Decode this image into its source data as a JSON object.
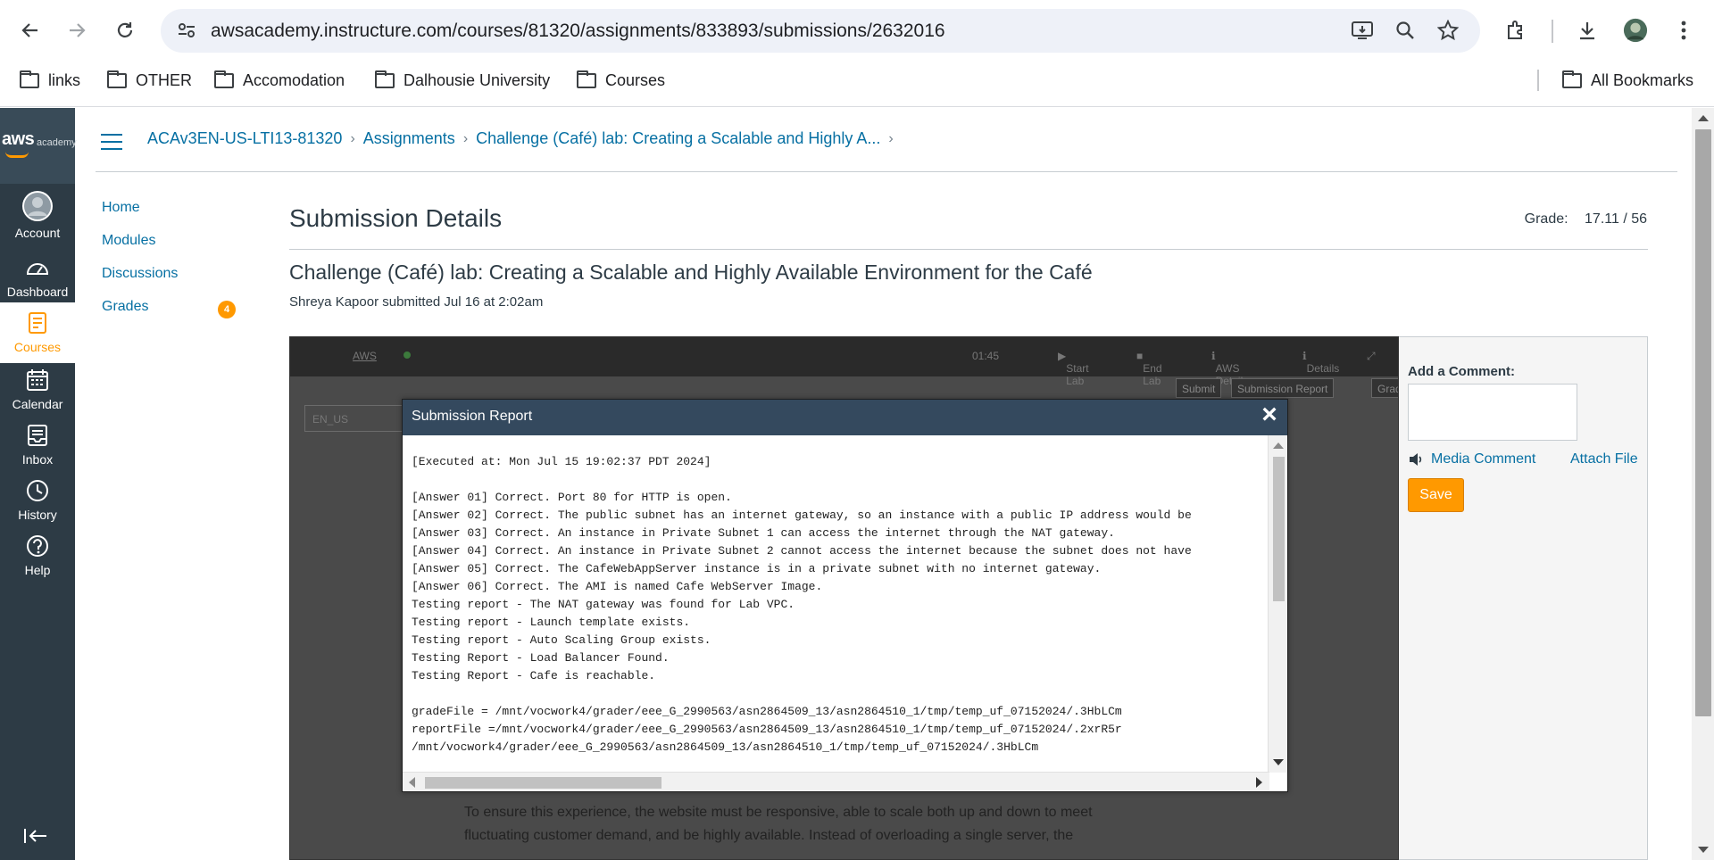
{
  "browser": {
    "url": "awsacademy.instructure.com/courses/81320/assignments/833893/submissions/2632016",
    "bookmarks": [
      "links",
      "OTHER",
      "Accomodation",
      "Dalhousie University",
      "Courses"
    ],
    "all_bookmarks": "All Bookmarks"
  },
  "global_nav": {
    "logo_aws": "aws",
    "logo_academy": "academy",
    "items": [
      {
        "label": "Account",
        "icon": "account-icon"
      },
      {
        "label": "Dashboard",
        "icon": "dashboard-icon"
      },
      {
        "label": "Courses",
        "icon": "courses-icon"
      },
      {
        "label": "Calendar",
        "icon": "calendar-icon"
      },
      {
        "label": "Inbox",
        "icon": "inbox-icon"
      },
      {
        "label": "History",
        "icon": "history-icon"
      },
      {
        "label": "Help",
        "icon": "help-icon"
      }
    ]
  },
  "breadcrumb": {
    "course": "ACAv3EN-US-LTI13-81320",
    "section": "Assignments",
    "assignment": "Challenge (Café) lab: Creating a Scalable and Highly A..."
  },
  "course_menu": {
    "items": [
      "Home",
      "Modules",
      "Discussions",
      "Grades"
    ],
    "grades_badge": "4"
  },
  "main": {
    "title": "Submission Details",
    "grade_label": "Grade:",
    "grade_value": "17.11 / 56",
    "assignment_title": "Challenge (Café) lab: Creating a Scalable and Highly Available Environment for the Café",
    "submitted_text": "Shreya Kapoor submitted Jul 16 at 2:02am"
  },
  "lab": {
    "aws": "AWS",
    "timer": "01:45",
    "start_lab": "Start Lab",
    "end_lab": "End Lab",
    "aws_details": "AWS Details",
    "details": "Details",
    "submit": "Submit",
    "submission_report": "Submission Report",
    "grades": "Grades",
    "lang": "EN_US",
    "body_text": "To ensure this experience, the website must be responsive, able to scale both up and down to meet fluctuating customer demand, and be highly available. Instead of overloading a single server, the"
  },
  "modal": {
    "title": "Submission Report",
    "lines": [
      "[Executed at: Mon Jul 15 19:02:37 PDT 2024]",
      "",
      "[Answer 01] Correct. Port 80 for HTTP is open.",
      "[Answer 02] Correct. The public subnet has an internet gateway, so an instance with a public IP address would be",
      "[Answer 03] Correct. An instance in Private Subnet 1 can access the internet through the NAT gateway.",
      "[Answer 04] Correct. An instance in Private Subnet 2 cannot access the internet because the subnet does not have",
      "[Answer 05] Correct. The CafeWebAppServer instance is in a private subnet with no internet gateway.",
      "[Answer 06] Correct. The AMI is named Cafe WebServer Image.",
      "Testing report - The NAT gateway was found for Lab VPC.",
      "Testing report - Launch template exists.",
      "Testing report - Auto Scaling Group exists.",
      "Testing Report - Load Balancer Found.",
      "Testing Report - Cafe is reachable.",
      "",
      "gradeFile = /mnt/vocwork4/grader/eee_G_2990563/asn2864509_13/asn2864510_1/tmp/temp_uf_07152024/.3HbLCm",
      "reportFile =/mnt/vocwork4/grader/eee_G_2990563/asn2864509_13/asn2864510_1/tmp/temp_uf_07152024/.2xrR5r",
      "/mnt/vocwork4/grader/eee_G_2990563/asn2864509_13/asn2864510_1/tmp/temp_uf_07152024/.3HbLCm"
    ]
  },
  "comment": {
    "label": "Add a Comment:",
    "media_comment": "Media Comment",
    "attach_file": "Attach File",
    "save": "Save"
  },
  "colors": {
    "link": "#0770a3",
    "nav_bg": "#2d3b45",
    "accent": "#ff9900",
    "modal_header": "#34495e"
  }
}
